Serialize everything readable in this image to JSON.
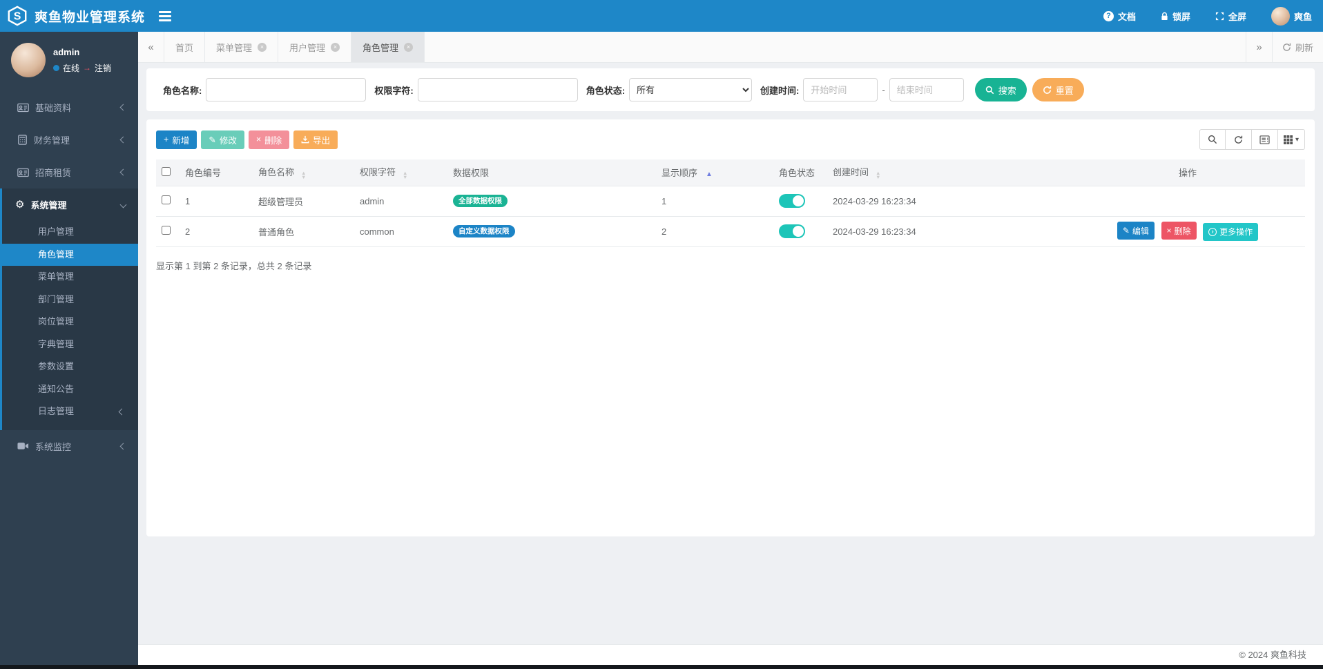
{
  "colors": {
    "navbar_blue": "#1e87c8",
    "sidebar_dark": "#2f4050",
    "primary": "#1c84c6",
    "success": "#1ab394",
    "warning": "#f8ac59",
    "danger": "#ed5565",
    "info": "#23c6c8",
    "toggle_on": "#1dc5b8",
    "sort_active": "#6f7de0"
  },
  "icons": {
    "gear": "⚙",
    "question": "?",
    "pencil": "✎",
    "close": "×",
    "plus": "+",
    "double_left": "«",
    "double_right": "»",
    "sort_up": "▲",
    "sort_down": "▼",
    "caret_down": "▾",
    "more_chevron": "›",
    "logout_arrow": "→",
    "status_dot": "●"
  },
  "navbar": {
    "brand": "爽鱼物业管理系统",
    "docs": "文档",
    "lock": "锁屏",
    "fullscreen": "全屏",
    "username": "爽鱼"
  },
  "sidebar": {
    "user": {
      "name": "admin",
      "status": "在线",
      "logout": "注销"
    },
    "items": [
      {
        "label": "基础资料"
      },
      {
        "label": "财务管理"
      },
      {
        "label": "招商租赁"
      },
      {
        "label": "系统管理",
        "children": [
          "用户管理",
          "角色管理",
          "菜单管理",
          "部门管理",
          "岗位管理",
          "字典管理",
          "参数设置",
          "通知公告",
          "日志管理"
        ],
        "active_child": "角色管理"
      },
      {
        "label": "系统监控"
      }
    ]
  },
  "tabs": {
    "refresh_label": "刷新",
    "items": [
      {
        "label": "首页",
        "closable": false,
        "active": false
      },
      {
        "label": "菜单管理",
        "closable": true,
        "active": false
      },
      {
        "label": "用户管理",
        "closable": true,
        "active": false
      },
      {
        "label": "角色管理",
        "closable": true,
        "active": true
      }
    ]
  },
  "filters": {
    "role_name_label": "角色名称:",
    "perm_label": "权限字符:",
    "status_label": "角色状态:",
    "status_value": "所有",
    "created_label": "创建时间:",
    "start_placeholder": "开始时间",
    "range_separator": "-",
    "end_placeholder": "结束时间",
    "search_label": "搜索",
    "reset_label": "重置"
  },
  "toolbar": {
    "add_label": "新增",
    "edit_label": "修改",
    "delete_label": "删除",
    "export_label": "导出"
  },
  "table": {
    "headers": {
      "id": "角色编号",
      "name": "角色名称",
      "perm": "权限字符",
      "scope": "数据权限",
      "order": "显示顺序",
      "status": "角色状态",
      "created": "创建时间",
      "ops": "操作"
    },
    "rows": [
      {
        "id": "1",
        "name": "超级管理员",
        "perm": "admin",
        "scope": "全部数据权限",
        "scope_color": "green",
        "order": "1",
        "status": "on",
        "created": "2024-03-29 16:23:34",
        "actions": []
      },
      {
        "id": "2",
        "name": "普通角色",
        "perm": "common",
        "scope": "自定义数据权限",
        "scope_color": "blue",
        "order": "2",
        "status": "on",
        "created": "2024-03-29 16:23:34",
        "actions": [
          "编辑",
          "删除",
          "更多操作"
        ]
      }
    ],
    "summary": "显示第 1 到第 2 条记录，总共 2 条记录"
  },
  "footer": {
    "copyright": "© 2024 爽鱼科技"
  }
}
